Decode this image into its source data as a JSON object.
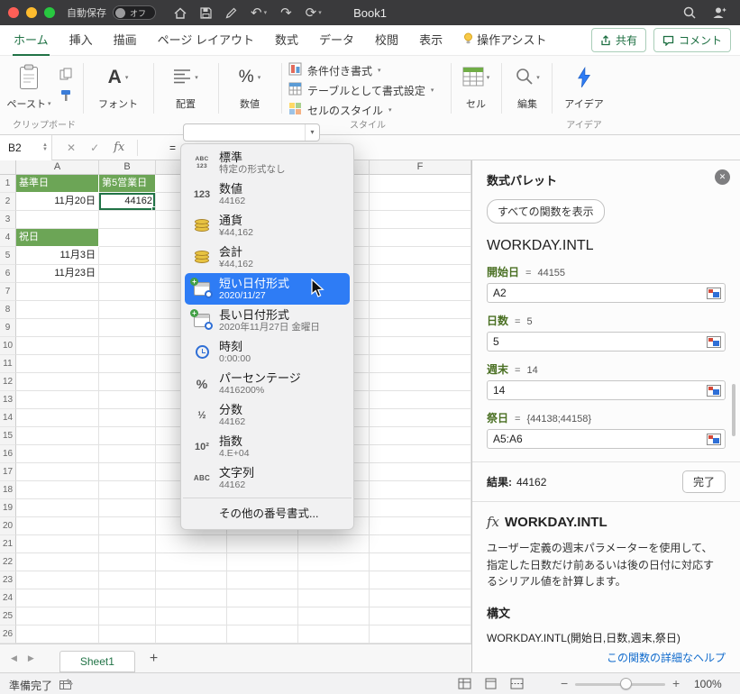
{
  "titlebar": {
    "autosave_label": "自動保存",
    "autosave_state": "オフ",
    "title": "Book1"
  },
  "ribbon_tabs": {
    "items": [
      {
        "label": "ホーム",
        "active": true
      },
      {
        "label": "挿入"
      },
      {
        "label": "描画"
      },
      {
        "label": "ページ レイアウト"
      },
      {
        "label": "数式"
      },
      {
        "label": "データ"
      },
      {
        "label": "校閲"
      },
      {
        "label": "表示"
      },
      {
        "label": "操作アシスト",
        "icon": "lightbulb-icon"
      }
    ],
    "share_label": "共有",
    "comments_label": "コメント"
  },
  "ribbon": {
    "paste_label": "ペースト",
    "clipboard_group_label": "クリップボード",
    "font_label": "フォント",
    "alignment_label": "配置",
    "number_label": "数値",
    "styles": [
      "条件付き書式",
      "テーブルとして書式設定",
      "セルのスタイル"
    ],
    "styles_group_label": "スタイル",
    "cells_label": "セル",
    "editing_label": "編集",
    "ideas_label": "アイデア",
    "ideas_group_label": "アイデア"
  },
  "formula_bar": {
    "cell_ref": "B2",
    "fx_label": "fx",
    "formula": "="
  },
  "number_format_menu": {
    "combo_value": "",
    "items": [
      {
        "icon": "general-format-icon",
        "label": "標準",
        "sample": "特定の形式なし"
      },
      {
        "icon": "number-format-icon",
        "label": "数値",
        "sample": "44162"
      },
      {
        "icon": "currency-format-icon",
        "label": "通貨",
        "sample": "¥44,162"
      },
      {
        "icon": "accounting-format-icon",
        "label": "会計",
        "sample": "¥44,162"
      },
      {
        "icon": "short-date-format-icon",
        "label": "短い日付形式",
        "sample": "2020/11/27",
        "highlighted": true
      },
      {
        "icon": "long-date-format-icon",
        "label": "長い日付形式",
        "sample": "2020年11月27日 金曜日"
      },
      {
        "icon": "time-format-icon",
        "label": "時刻",
        "sample": "0:00:00"
      },
      {
        "icon": "percent-format-icon",
        "label": "パーセンテージ",
        "sample": "4416200%"
      },
      {
        "icon": "fraction-format-icon",
        "label": "分数",
        "sample": "44162"
      },
      {
        "icon": "scientific-format-icon",
        "label": "指数",
        "sample": "4.E+04"
      },
      {
        "icon": "text-format-icon",
        "label": "文字列",
        "sample": "44162"
      }
    ],
    "footer": "その他の番号書式..."
  },
  "grid": {
    "columns": [
      "A",
      "B",
      "C",
      "D",
      "E",
      "F"
    ],
    "row_count": 26,
    "selected_cell": "B2",
    "cells": [
      {
        "col": "A",
        "row": 1,
        "text": "基準日",
        "style": "header"
      },
      {
        "col": "B",
        "row": 1,
        "text": "第5営業日",
        "style": "header"
      },
      {
        "col": "A",
        "row": 2,
        "text": "11月20日",
        "style": "date"
      },
      {
        "col": "B",
        "row": 2,
        "text": "44162",
        "style": "number",
        "selected": true
      },
      {
        "col": "A",
        "row": 4,
        "text": "祝日",
        "style": "header"
      },
      {
        "col": "A",
        "row": 5,
        "text": "11月3日",
        "style": "date"
      },
      {
        "col": "A",
        "row": 6,
        "text": "11月23日",
        "style": "date"
      }
    ]
  },
  "formula_palette": {
    "title": "数式パレット",
    "show_all_button": "すべての関数を表示",
    "function_name": "WORKDAY.INTL",
    "fields": [
      {
        "label": "開始日",
        "preview": "44155",
        "value": "A2"
      },
      {
        "label": "日数",
        "preview": "5",
        "value": "5"
      },
      {
        "label": "週末",
        "preview": "14",
        "value": "14"
      },
      {
        "label": "祭日",
        "preview": "{44138;44158}",
        "value": "A5:A6"
      }
    ],
    "result_label": "結果:",
    "result_value": "44162",
    "done_button": "完了",
    "help": {
      "fx": "fx",
      "title": "WORKDAY.INTL",
      "description": "ユーザー定義の週末パラメーターを使用して、指定した日数だけ前あるいは後の日付に対応するシリアル値を計算します。",
      "syntax_label": "構文",
      "syntax": "WORKDAY.INTL(開始日,日数,週末,祭日)",
      "link": "この関数の詳細なヘルプ"
    }
  },
  "sheet_tabs": {
    "tabs": [
      {
        "label": "Sheet1",
        "active": true
      }
    ],
    "add_label": "+"
  },
  "status_bar": {
    "status": "準備完了",
    "zoom": "100%"
  },
  "colors": {
    "excel_green": "#217346",
    "header_fill": "#6ca556",
    "selection_blue": "#2e7cf5",
    "link_blue": "#0f6acc"
  }
}
